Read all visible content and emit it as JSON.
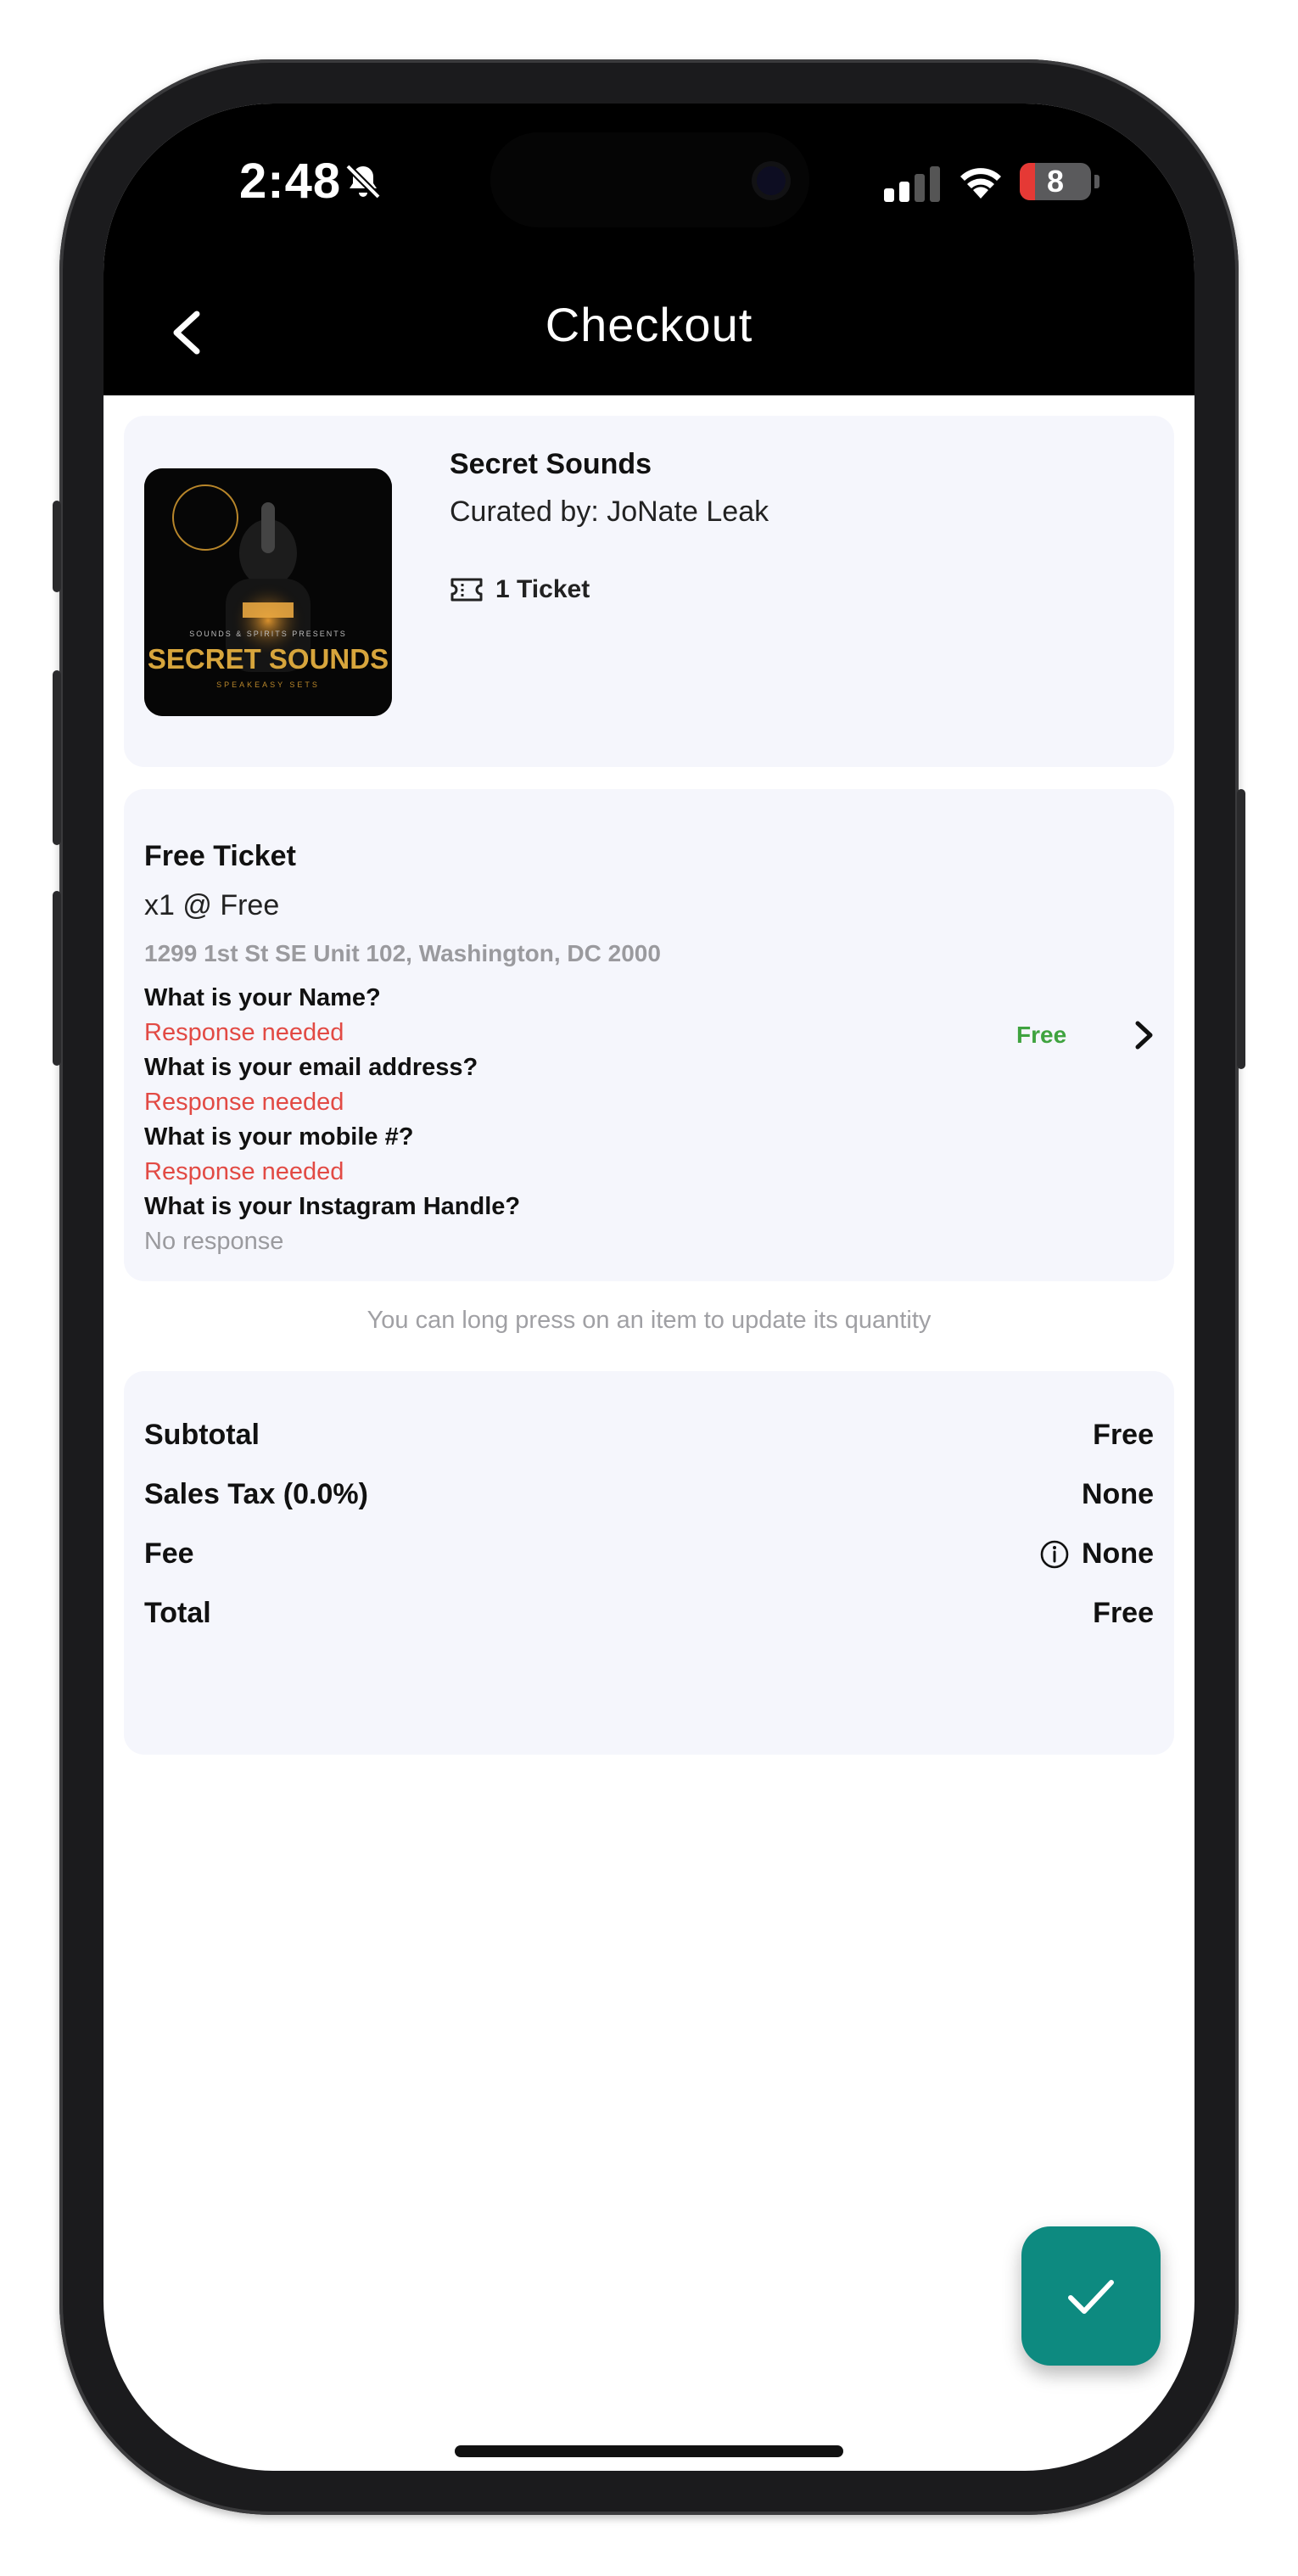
{
  "status_bar": {
    "time": "2:48",
    "battery": "8"
  },
  "header": {
    "title": "Checkout"
  },
  "event": {
    "name": "Secret Sounds",
    "curator": "Curated by: JoNate Leak",
    "ticket_count": "1 Ticket",
    "art": {
      "presenter": "SOUNDS & SPIRITS PRESENTS",
      "title": "SECRET SOUNDS",
      "subtitle": "SPEAKEASY SETS"
    }
  },
  "ticket": {
    "title": "Free Ticket",
    "quantity": "x1 @ Free",
    "address": "1299 1st St SE Unit 102, Washington, DC 2000",
    "price": "Free",
    "questions": [
      {
        "question": "What is your Name?",
        "answer": "Response needed"
      },
      {
        "question": "What is your email address?",
        "answer": "Response needed"
      },
      {
        "question": "What is your mobile #?",
        "answer": "Response needed"
      },
      {
        "question": "What is your Instagram Handle?",
        "answer": "No response"
      }
    ]
  },
  "hint": "You can long press on an item to update its quantity",
  "summary": {
    "subtotal_label": "Subtotal",
    "subtotal_value": "Free",
    "tax_label": "Sales Tax (0.0%)",
    "tax_value": "None",
    "fee_label": "Fee",
    "fee_value": "None",
    "total_label": "Total",
    "total_value": "Free"
  },
  "colors": {
    "accent": "#0d8a80",
    "response_needed": "#e24a44",
    "price_free": "#3fa33f",
    "card_bg": "#f5f6fc"
  },
  "icons": {
    "back": "chevron-left-icon",
    "ticket": "ticket-icon",
    "chevron": "chevron-right-icon",
    "info": "info-icon",
    "confirm": "check-icon"
  }
}
